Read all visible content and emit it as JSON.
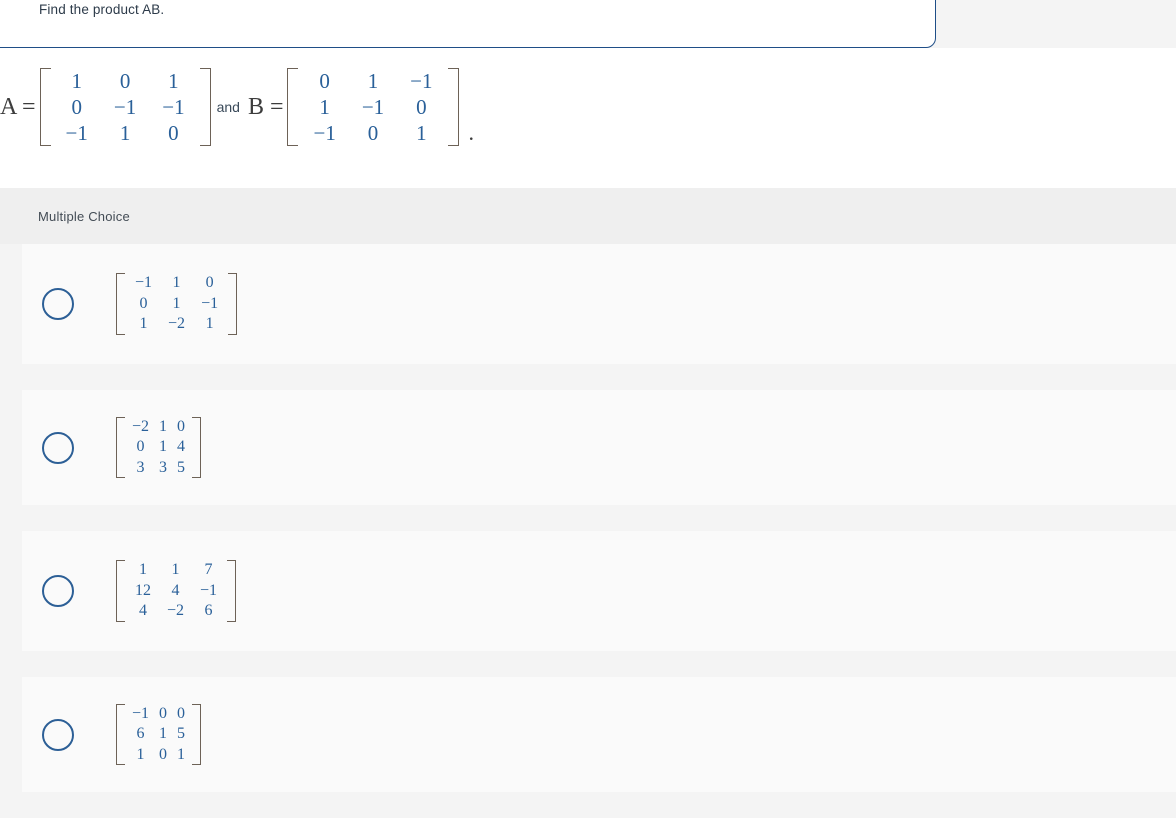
{
  "question": {
    "clipped_top_line": "",
    "prompt": "Find the product AB.",
    "equals_a": "A =",
    "connector": "and",
    "equals_b": "B =",
    "trailing_punctuation": ".",
    "matrix_a": [
      [
        "1",
        "0",
        "1"
      ],
      [
        "0",
        "−1",
        "−1"
      ],
      [
        "−1",
        "1",
        "0"
      ]
    ],
    "matrix_b": [
      [
        "0",
        "1",
        "−1"
      ],
      [
        "1",
        "−1",
        "0"
      ],
      [
        "−1",
        "0",
        "1"
      ]
    ]
  },
  "section": {
    "label": "Multiple Choice"
  },
  "options": [
    {
      "id": "option-a",
      "matrix": [
        [
          "−1",
          "1",
          "0"
        ],
        [
          "0",
          "1",
          "−1"
        ],
        [
          "1",
          "−2",
          "1"
        ]
      ],
      "selected": false
    },
    {
      "id": "option-b",
      "matrix": [
        [
          "−2",
          "1",
          "0"
        ],
        [
          "0",
          "1",
          "4"
        ],
        [
          "3",
          "3",
          "5"
        ]
      ],
      "selected": false
    },
    {
      "id": "option-c",
      "matrix": [
        [
          "1",
          "1",
          "7"
        ],
        [
          "12",
          "4",
          "−1"
        ],
        [
          "4",
          "−2",
          "6"
        ]
      ],
      "selected": false
    },
    {
      "id": "option-d",
      "matrix": [
        [
          "−1",
          "0",
          "0"
        ],
        [
          "6",
          "1",
          "5"
        ],
        [
          "1",
          "0",
          "1"
        ]
      ],
      "selected": false
    }
  ],
  "colors": {
    "page_background": "#f4f4f4",
    "card_background": "#fafafa",
    "section_band": "#efefef",
    "question_border": "#1f4e87",
    "math_text": "#2a6099",
    "bracket": "#6d6257",
    "radio_border": "#2c5f96",
    "body_text": "#2d3b4a"
  }
}
